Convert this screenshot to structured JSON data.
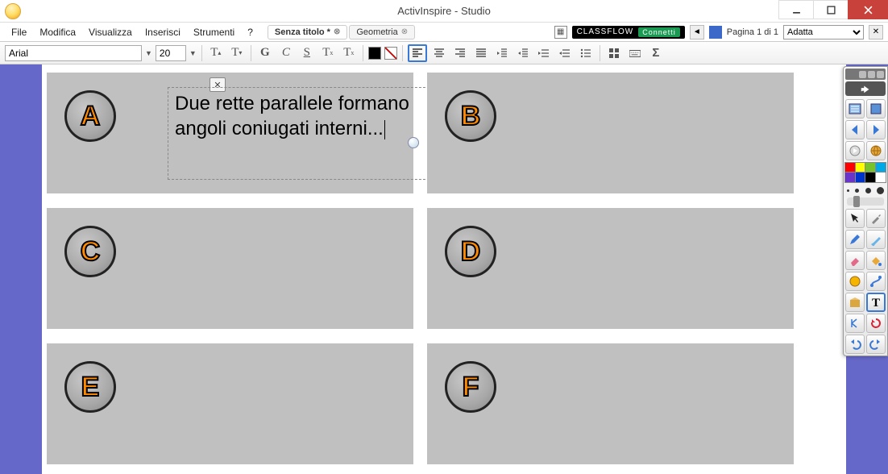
{
  "titlebar": {
    "title": "ActivInspire - Studio"
  },
  "menu": {
    "items": [
      "File",
      "Modifica",
      "Visualizza",
      "Inserisci",
      "Strumenti",
      "?"
    ],
    "tabs": [
      {
        "label": "Senza titolo *",
        "active": true
      },
      {
        "label": "Geometria",
        "active": false
      }
    ],
    "classflow_label": "CLASSFLOW",
    "classflow_connect": "Connetti",
    "page_nav": "Pagina 1 di 1",
    "zoom_value": "Adatta"
  },
  "toolbar": {
    "font": "Arial",
    "size": "20"
  },
  "cards": {
    "a": "A",
    "b": "B",
    "c": "C",
    "d": "D",
    "e": "E",
    "f": "F",
    "text_a": "Due rette parallele formano angoli coniugati interni..."
  },
  "toolpanel": {
    "colors_top": [
      "#ff0000",
      "#ffff00",
      "#78c22c",
      "#00a9e6"
    ],
    "colors_bottom": [
      "#6a33c9",
      "#0033cc",
      "#000000",
      "#ffffff"
    ]
  }
}
